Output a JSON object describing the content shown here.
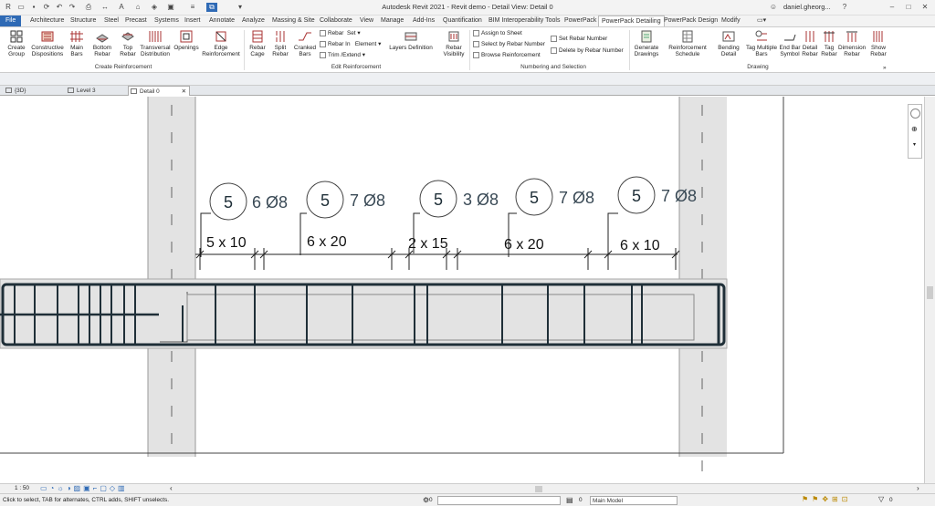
{
  "app_title": "Autodesk Revit 2021 - Revit demo - Detail View: Detail 0",
  "user": "daniel.gheorg...",
  "tabs": [
    "File",
    "Architecture",
    "Structure",
    "Steel",
    "Precast",
    "Systems",
    "Insert",
    "Annotate",
    "Analyze",
    "Massing & Site",
    "Collaborate",
    "View",
    "Manage",
    "Add-Ins",
    "Quantification",
    "BIM Interoperability Tools",
    "PowerPack",
    "PowerPack Detailing",
    "PowerPack Design",
    "Modify"
  ],
  "active_tab": "PowerPack Detailing",
  "ribbon": {
    "create_group": [
      "Create Group",
      "Constructive Dispositions",
      "Main Bars",
      "Bottom Rebar",
      "Top Rebar",
      "Transversal Distribution",
      "Openings",
      "Edge Reinforcement"
    ],
    "create_label": "Create Reinforcement",
    "edit_group": [
      "Rebar Cage",
      "Split Rebar",
      "Cranked Bars"
    ],
    "edit_small": [
      "Rebar",
      "Set",
      "Rebar In",
      "Element",
      "Trim /Extend"
    ],
    "edit_label": "Edit Reinforcement",
    "layers": "Layers Definition",
    "visibility": "Rebar Visibility",
    "numbering_small": [
      "Assign to Sheet",
      "Select by Rebar Number",
      "Browse Reinforcement",
      "Set Rebar Number",
      "Delete by Rebar Number"
    ],
    "numbering_label": "Numbering and Selection",
    "drawing_group": [
      "Generate Drawings",
      "Reinforcement Schedule",
      "Bending Detail",
      "Tag Multiple Bars",
      "End Bar Symbol",
      "Detail Rebar",
      "Tag Rebar",
      "Dimension Rebar",
      "Show Rebar"
    ],
    "drawing_label": "Drawing"
  },
  "doc_tabs": [
    "{3D}",
    "Level 3",
    "Detail 0"
  ],
  "drawing": {
    "tags": [
      {
        "num": "5",
        "text": "6 Ø8"
      },
      {
        "num": "5",
        "text": "7 Ø8"
      },
      {
        "num": "5",
        "text": "3 Ø8"
      },
      {
        "num": "5",
        "text": "7 Ø8"
      },
      {
        "num": "5",
        "text": "7 Ø8"
      }
    ],
    "dims": [
      "5 x 10",
      "6 x 20",
      "2 x 15",
      "6 x 20",
      "6 x 10"
    ]
  },
  "status": {
    "message": "Click to select, TAB for alternates, CTRL adds, SHIFT unselects.",
    "scale": "1 : 50",
    "model": "Main Model",
    "workset_value": "0"
  },
  "colors": {
    "accent": "#2f6ab5",
    "rebar": "#1f2f38",
    "concrete": "#e3e3e3"
  }
}
